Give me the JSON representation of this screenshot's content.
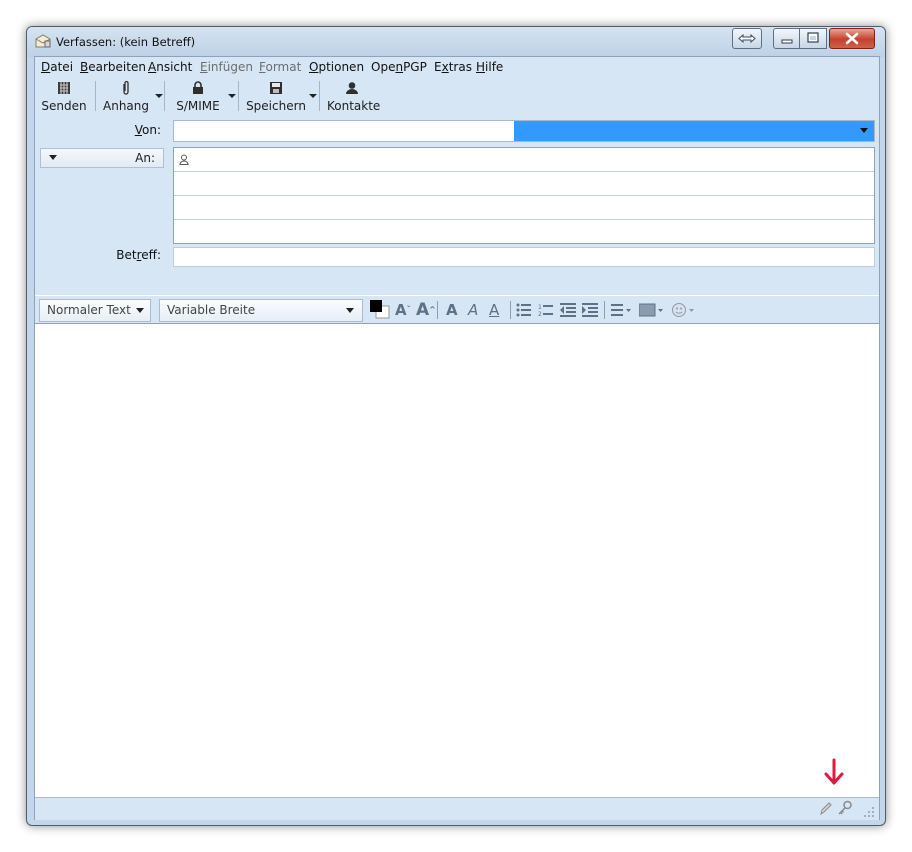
{
  "window": {
    "title": "Verfassen: (kein Betreff)"
  },
  "menu": [
    {
      "label": "Datei",
      "accel": "D",
      "rest": "atei",
      "enabled": true
    },
    {
      "label": "Bearbeiten",
      "accel": "B",
      "rest": "earbeiten",
      "enabled": true
    },
    {
      "label": "Ansicht",
      "accel": "A",
      "rest": "nsicht",
      "enabled": true
    },
    {
      "label": "Einfügen",
      "accel": "E",
      "rest": "infügen",
      "enabled": false
    },
    {
      "label": "Format",
      "accel": "F",
      "rest": "ormat",
      "enabled": false
    },
    {
      "label": "Optionen",
      "accel": "O",
      "rest": "ptionen",
      "enabled": true
    },
    {
      "label": "OpenPGP",
      "pre": "Ope",
      "accel": "n",
      "rest": "PGP",
      "enabled": true
    },
    {
      "label": "Extras",
      "pre": "E",
      "accel": "x",
      "rest": "tras",
      "enabled": true
    },
    {
      "label": "Hilfe",
      "accel": "H",
      "rest": "ilfe",
      "enabled": true
    }
  ],
  "toolbar": {
    "send": {
      "label": "Senden",
      "icon": "send-icon"
    },
    "attach": {
      "label": "Anhang",
      "icon": "paperclip-icon"
    },
    "smime": {
      "label": "S/MIME",
      "icon": "lock-icon"
    },
    "save": {
      "label": "Speichern",
      "icon": "floppy-disk-icon"
    },
    "contacts": {
      "label": "Kontakte",
      "icon": "contact-person-icon"
    }
  },
  "headers": {
    "from_label": "Von:",
    "to_type": "An:",
    "subject_label": "Betreff:",
    "subject_value": ""
  },
  "format_toolbar": {
    "paragraph_style": "Normaler Text",
    "font": "Variable Breite"
  },
  "colors": {
    "from_selection": "#3399ff",
    "status_arrow": "#e0193f"
  }
}
